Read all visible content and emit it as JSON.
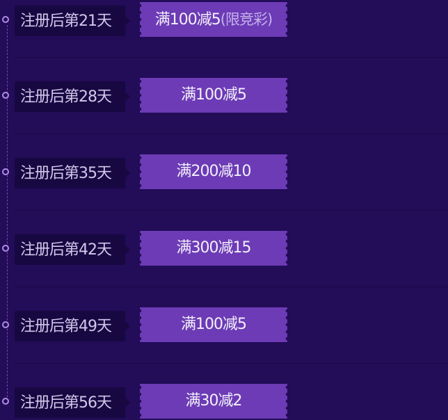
{
  "timeline": {
    "items": [
      {
        "day": "注册后第21天",
        "coupon": "满100减5",
        "note": "(限竞彩)"
      },
      {
        "day": "注册后第28天",
        "coupon": "满100减5",
        "note": ""
      },
      {
        "day": "注册后第35天",
        "coupon": "满200减10",
        "note": ""
      },
      {
        "day": "注册后第42天",
        "coupon": "满300减15",
        "note": ""
      },
      {
        "day": "注册后第49天",
        "coupon": "满100减5",
        "note": ""
      },
      {
        "day": "注册后第56天",
        "coupon": "满30减2",
        "note": ""
      }
    ]
  },
  "colors": {
    "background": "#230c58",
    "day_tag": "#170842",
    "coupon": "#6c3bb5",
    "accent": "#b08ce8"
  }
}
